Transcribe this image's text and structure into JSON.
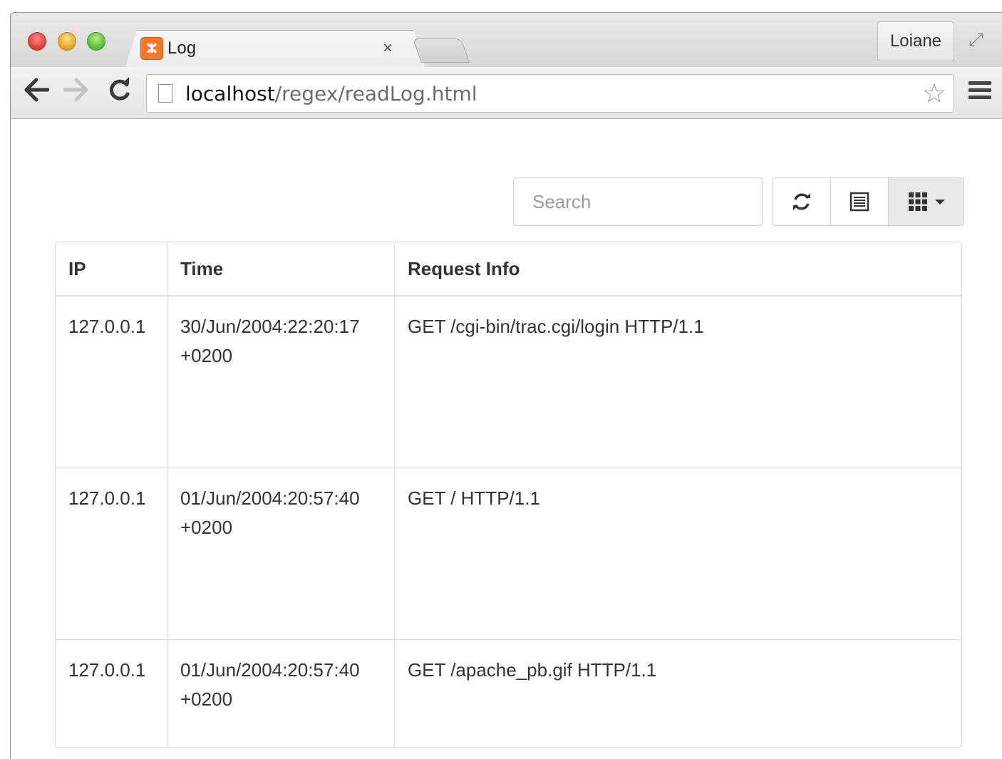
{
  "browser": {
    "tab": {
      "title": "Log",
      "favicon_glyph": "ⵣ",
      "close_glyph": "×"
    },
    "profile_name": "Loiane",
    "url_host": "localhost",
    "url_path": "/regex/readLog.html",
    "icons": {
      "back": "arrow-left-icon",
      "forward": "arrow-right-icon",
      "reload": "reload-icon",
      "star": "star-icon",
      "menu": "hamburger-menu-icon",
      "fullscreen": "fullscreen-icon"
    }
  },
  "toolbar": {
    "search_placeholder": "Search",
    "buttons": [
      {
        "name": "refresh",
        "icon": "refresh-icon"
      },
      {
        "name": "toggle-view",
        "icon": "list-icon"
      },
      {
        "name": "columns",
        "icon": "grid-icon"
      }
    ]
  },
  "table": {
    "headers": {
      "ip": "IP",
      "time": "Time",
      "request": "Request Info"
    },
    "rows": [
      {
        "ip": "127.0.0.1",
        "time": "30/Jun/2004:22:20:17",
        "tz": "+0200",
        "request": "GET /cgi-bin/trac.cgi/login HTTP/1.1"
      },
      {
        "ip": "127.0.0.1",
        "time": "01/Jun/2004:20:57:40",
        "tz": "+0200",
        "request": "GET / HTTP/1.1"
      },
      {
        "ip": "127.0.0.1",
        "time": "01/Jun/2004:20:57:40",
        "tz": "+0200",
        "request": "GET /apache_pb.gif HTTP/1.1"
      }
    ]
  }
}
